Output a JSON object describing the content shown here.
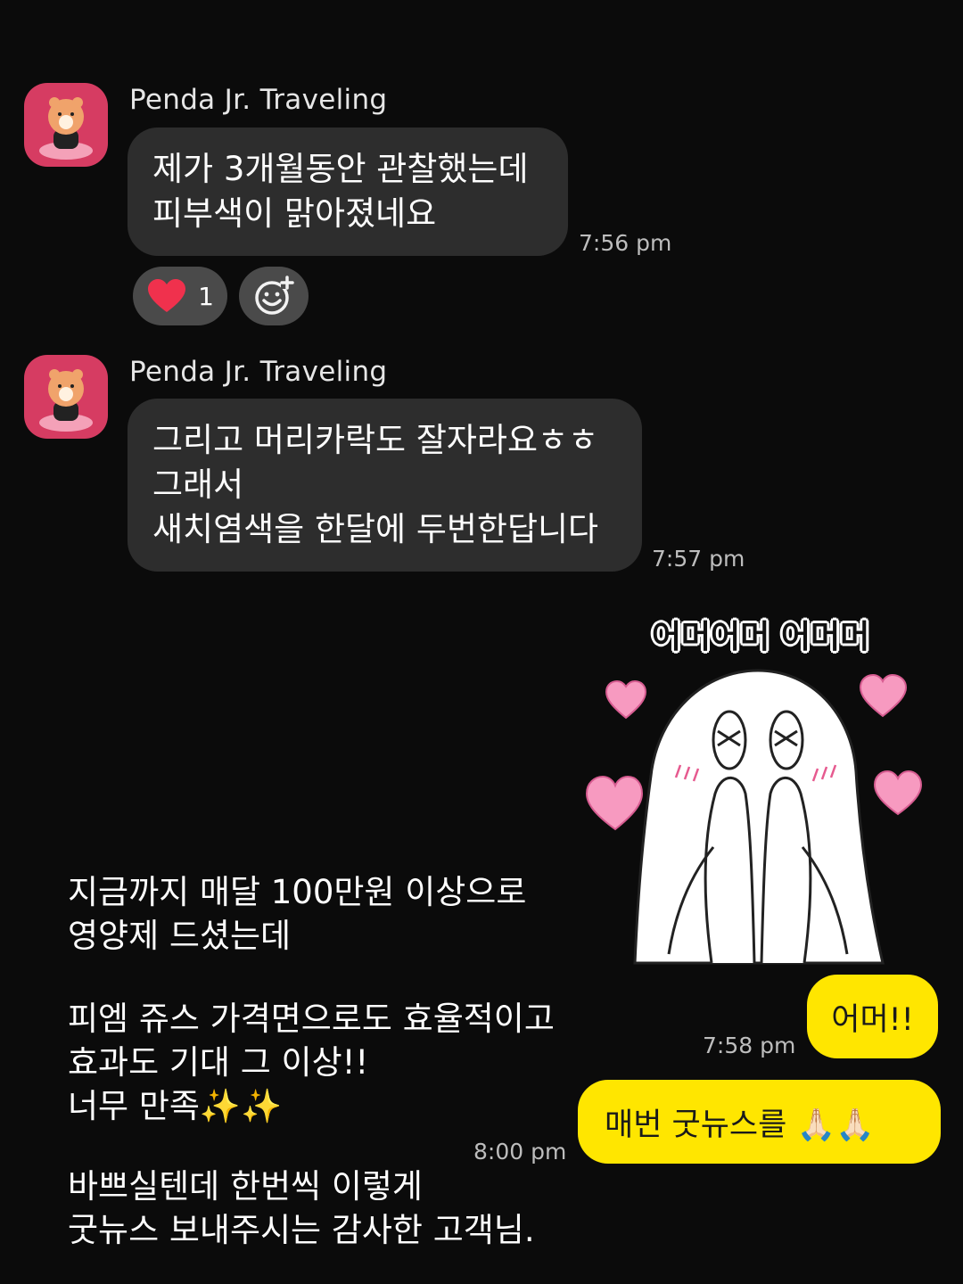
{
  "chat": {
    "messages": [
      {
        "sender": "Penda Jr. Traveling",
        "text": "제가 3개월동안 관찰했는데\n피부색이 맑아졌네요",
        "time": "7:56 pm",
        "reaction": {
          "icon": "heart-icon",
          "count": "1"
        }
      },
      {
        "sender": "Penda Jr. Traveling",
        "text": "그리고 머리카락도 잘자라요ㅎㅎ\n그래서\n새치염색을 한달에 두번한답니다",
        "time": "7:57 pm"
      }
    ],
    "sticker": {
      "caption": "어머어머 어머머"
    },
    "outgoing": [
      {
        "text": "어머!!",
        "time": "7:58 pm"
      },
      {
        "text": "매번 굿뉴스를 🙏🏻🙏🏻",
        "time": "8:00 pm"
      }
    ]
  },
  "overlay": {
    "paragraph1": "지금까지 매달 100만원 이상으로\n영양제 드셨는데",
    "paragraph2": "피엠 쥬스 가격면으로도 효율적이고\n효과도 기대 그 이상!!\n너무 만족✨✨",
    "paragraph3": "바쁘실텐데 한번씩 이렇게\n굿뉴스 보내주시는 감사한 고객님."
  },
  "colors": {
    "background": "#0b0b0b",
    "incoming_bubble": "#2d2d2d",
    "outgoing_bubble": "#ffe600",
    "avatar": "#d63c62",
    "heart": "#f0314d"
  }
}
